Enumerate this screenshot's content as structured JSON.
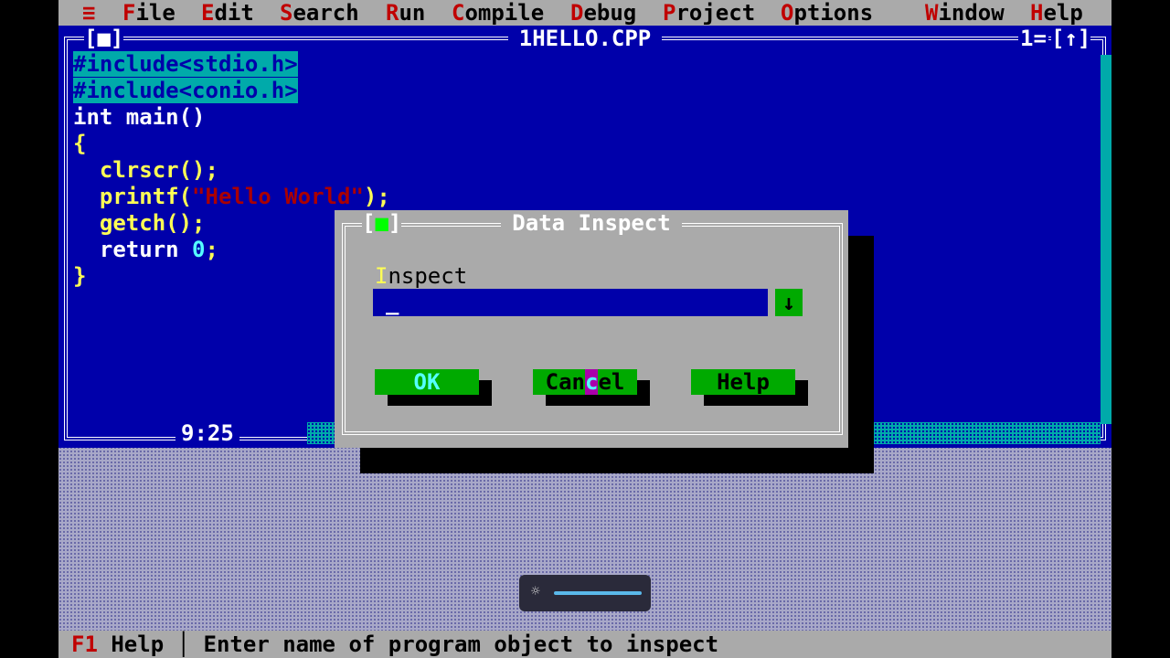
{
  "menu": {
    "system_icon": "≡",
    "items": [
      {
        "hot": "F",
        "rest": "ile"
      },
      {
        "hot": "E",
        "rest": "dit"
      },
      {
        "hot": "S",
        "rest": "earch"
      },
      {
        "hot": "R",
        "rest": "un"
      },
      {
        "hot": "C",
        "rest": "ompile"
      },
      {
        "hot": "D",
        "rest": "ebug"
      },
      {
        "hot": "P",
        "rest": "roject"
      },
      {
        "hot": "O",
        "rest": "ptions"
      },
      {
        "hot": "W",
        "rest": "indow"
      },
      {
        "hot": "H",
        "rest": "elp"
      }
    ]
  },
  "editor": {
    "title": "1HELLO.CPP",
    "close_box": "[■]",
    "window_number": "1=",
    "zoom_box": "[↑]",
    "cursor_position": "9:25",
    "code": [
      "#include<stdio.h>",
      "#include<conio.h>",
      "int main()",
      "{",
      "  clrscr();",
      "  printf(",
      "\"Hello World\"",
      ");",
      "  getch();",
      "  return ",
      "0",
      ";",
      "}"
    ]
  },
  "dialog": {
    "title": "Data Inspect",
    "close_box_left": "[",
    "close_box_mark": "■",
    "close_box_right": "]",
    "label_hot": "I",
    "label_rest": "nspect",
    "input_value": "_",
    "dropdown_icon": "↓",
    "buttons": {
      "ok": "OK",
      "cancel_a": "Can",
      "cancel_b": "c",
      "cancel_c": "el",
      "help": "Help"
    }
  },
  "status": {
    "key": "F1",
    "key_label": " Help",
    "separator": " │ ",
    "message": "Enter name of program object to inspect"
  },
  "overlay": {
    "icon": "☼"
  },
  "colors": {
    "editor_bg": "#0000aa",
    "menu_bg": "#aaaaaa",
    "hotkey": "#c00000",
    "code_text": "#ffff55",
    "button_bg": "#00aa00"
  }
}
